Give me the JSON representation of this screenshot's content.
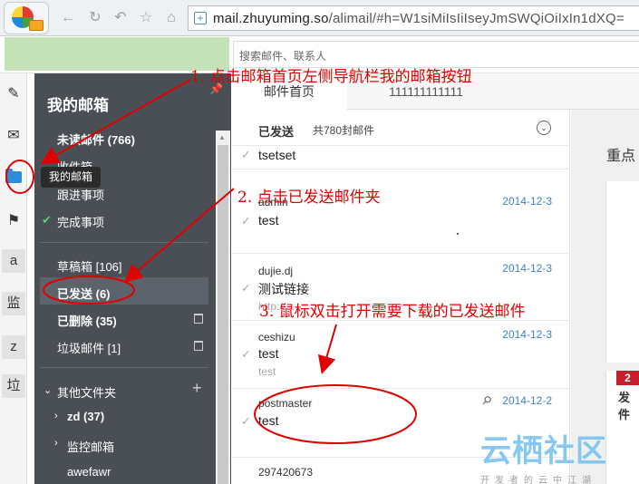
{
  "browser": {
    "url_domain": "mail.zhuyuming.so",
    "url_path": "/alimail/#h=W1siMiIsIiIseyJmSWQiOiIxIn1dXQ="
  },
  "search": {
    "placeholder": "搜索邮件、联系人"
  },
  "rail": {
    "letters": [
      "a",
      "监",
      "z",
      "垃"
    ]
  },
  "tooltip": "我的邮箱",
  "sidebar": {
    "title": "我的邮箱",
    "unread": "未读邮件 (766)",
    "inbox": "收件箱",
    "followup": "跟进事项",
    "done": "完成事项",
    "drafts": "草稿箱 [106]",
    "sent": "已发送 (6)",
    "deleted": "已删除 (35)",
    "spam": "垃圾邮件 [1]",
    "other_folders": "其他文件夹",
    "zd": "zd (37)",
    "monitor": "监控邮箱",
    "awefawr": "awefawr"
  },
  "tabs": {
    "home": "邮件首页",
    "second": "111111111111"
  },
  "list": {
    "title": "已发送",
    "count": "共780封邮件",
    "rows": [
      {
        "from": "",
        "subject": "tsetset",
        "preview": "",
        "date": ""
      },
      {
        "from": "admin",
        "subject": "test",
        "preview": "",
        "date": "2014-12-3"
      },
      {
        "from": "dujie.dj",
        "subject": "测试链接",
        "preview": "http://...",
        "date": "2014-12-3"
      },
      {
        "from": "ceshizu",
        "subject": "test",
        "preview": "test",
        "date": "2014-12-3"
      },
      {
        "from": "postmaster",
        "subject": "test",
        "preview": "",
        "date": "2014-12-2"
      },
      {
        "from": "297420673",
        "subject": "",
        "preview": "",
        "date": ""
      }
    ]
  },
  "right_pane": {
    "title": "重点",
    "badge": "2",
    "label": "发件"
  },
  "annotations": {
    "step1": "1. 点击邮箱首页左侧导航栏我的邮箱按钮",
    "step2": "2. 点击已发送邮件夹",
    "step3": "3. 鼠标双击打开需要下载的已发送邮件"
  },
  "watermark": {
    "main": "云栖社区",
    "sub": "开发者的云中江湖"
  }
}
